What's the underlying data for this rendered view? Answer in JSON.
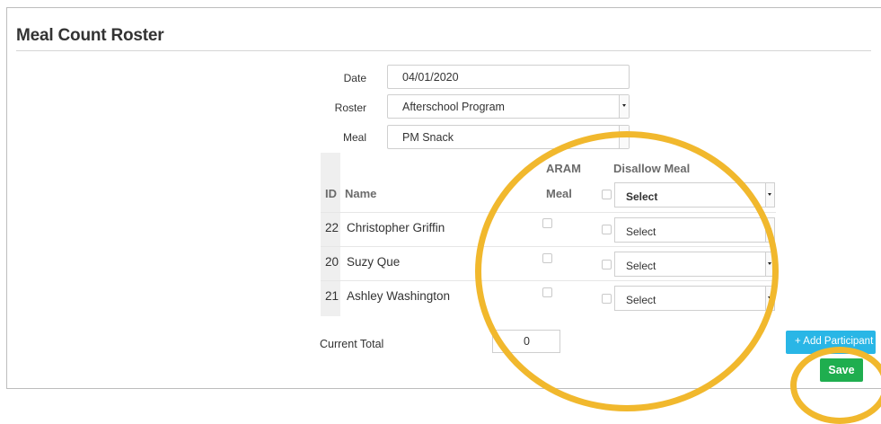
{
  "page": {
    "title": "Meal Count Roster"
  },
  "form": {
    "date": {
      "label": "Date",
      "value": "04/01/2020"
    },
    "roster": {
      "label": "Roster",
      "value": "Afterschool Program"
    },
    "meal": {
      "label": "Meal",
      "value": "PM Snack"
    }
  },
  "table": {
    "headers": {
      "id": "ID",
      "name": "Name",
      "aram_top": "ARAM",
      "aram_bottom": "Meal",
      "disallow": "Disallow Meal",
      "disallow_select": "Select"
    },
    "rows": [
      {
        "id": "22",
        "name": "Christopher Griffin",
        "select": "Select"
      },
      {
        "id": "20",
        "name": "Suzy Que",
        "select": "Select"
      },
      {
        "id": "21",
        "name": "Ashley Washington",
        "select": "Select"
      }
    ]
  },
  "footer": {
    "total_label": "Current Total",
    "total_value": "0",
    "add_button": "+ Add Participant",
    "save_button": "Save"
  },
  "colors": {
    "highlight": "#f1b82d",
    "add_button": "#29b6e6",
    "save_button": "#1fae4f"
  }
}
